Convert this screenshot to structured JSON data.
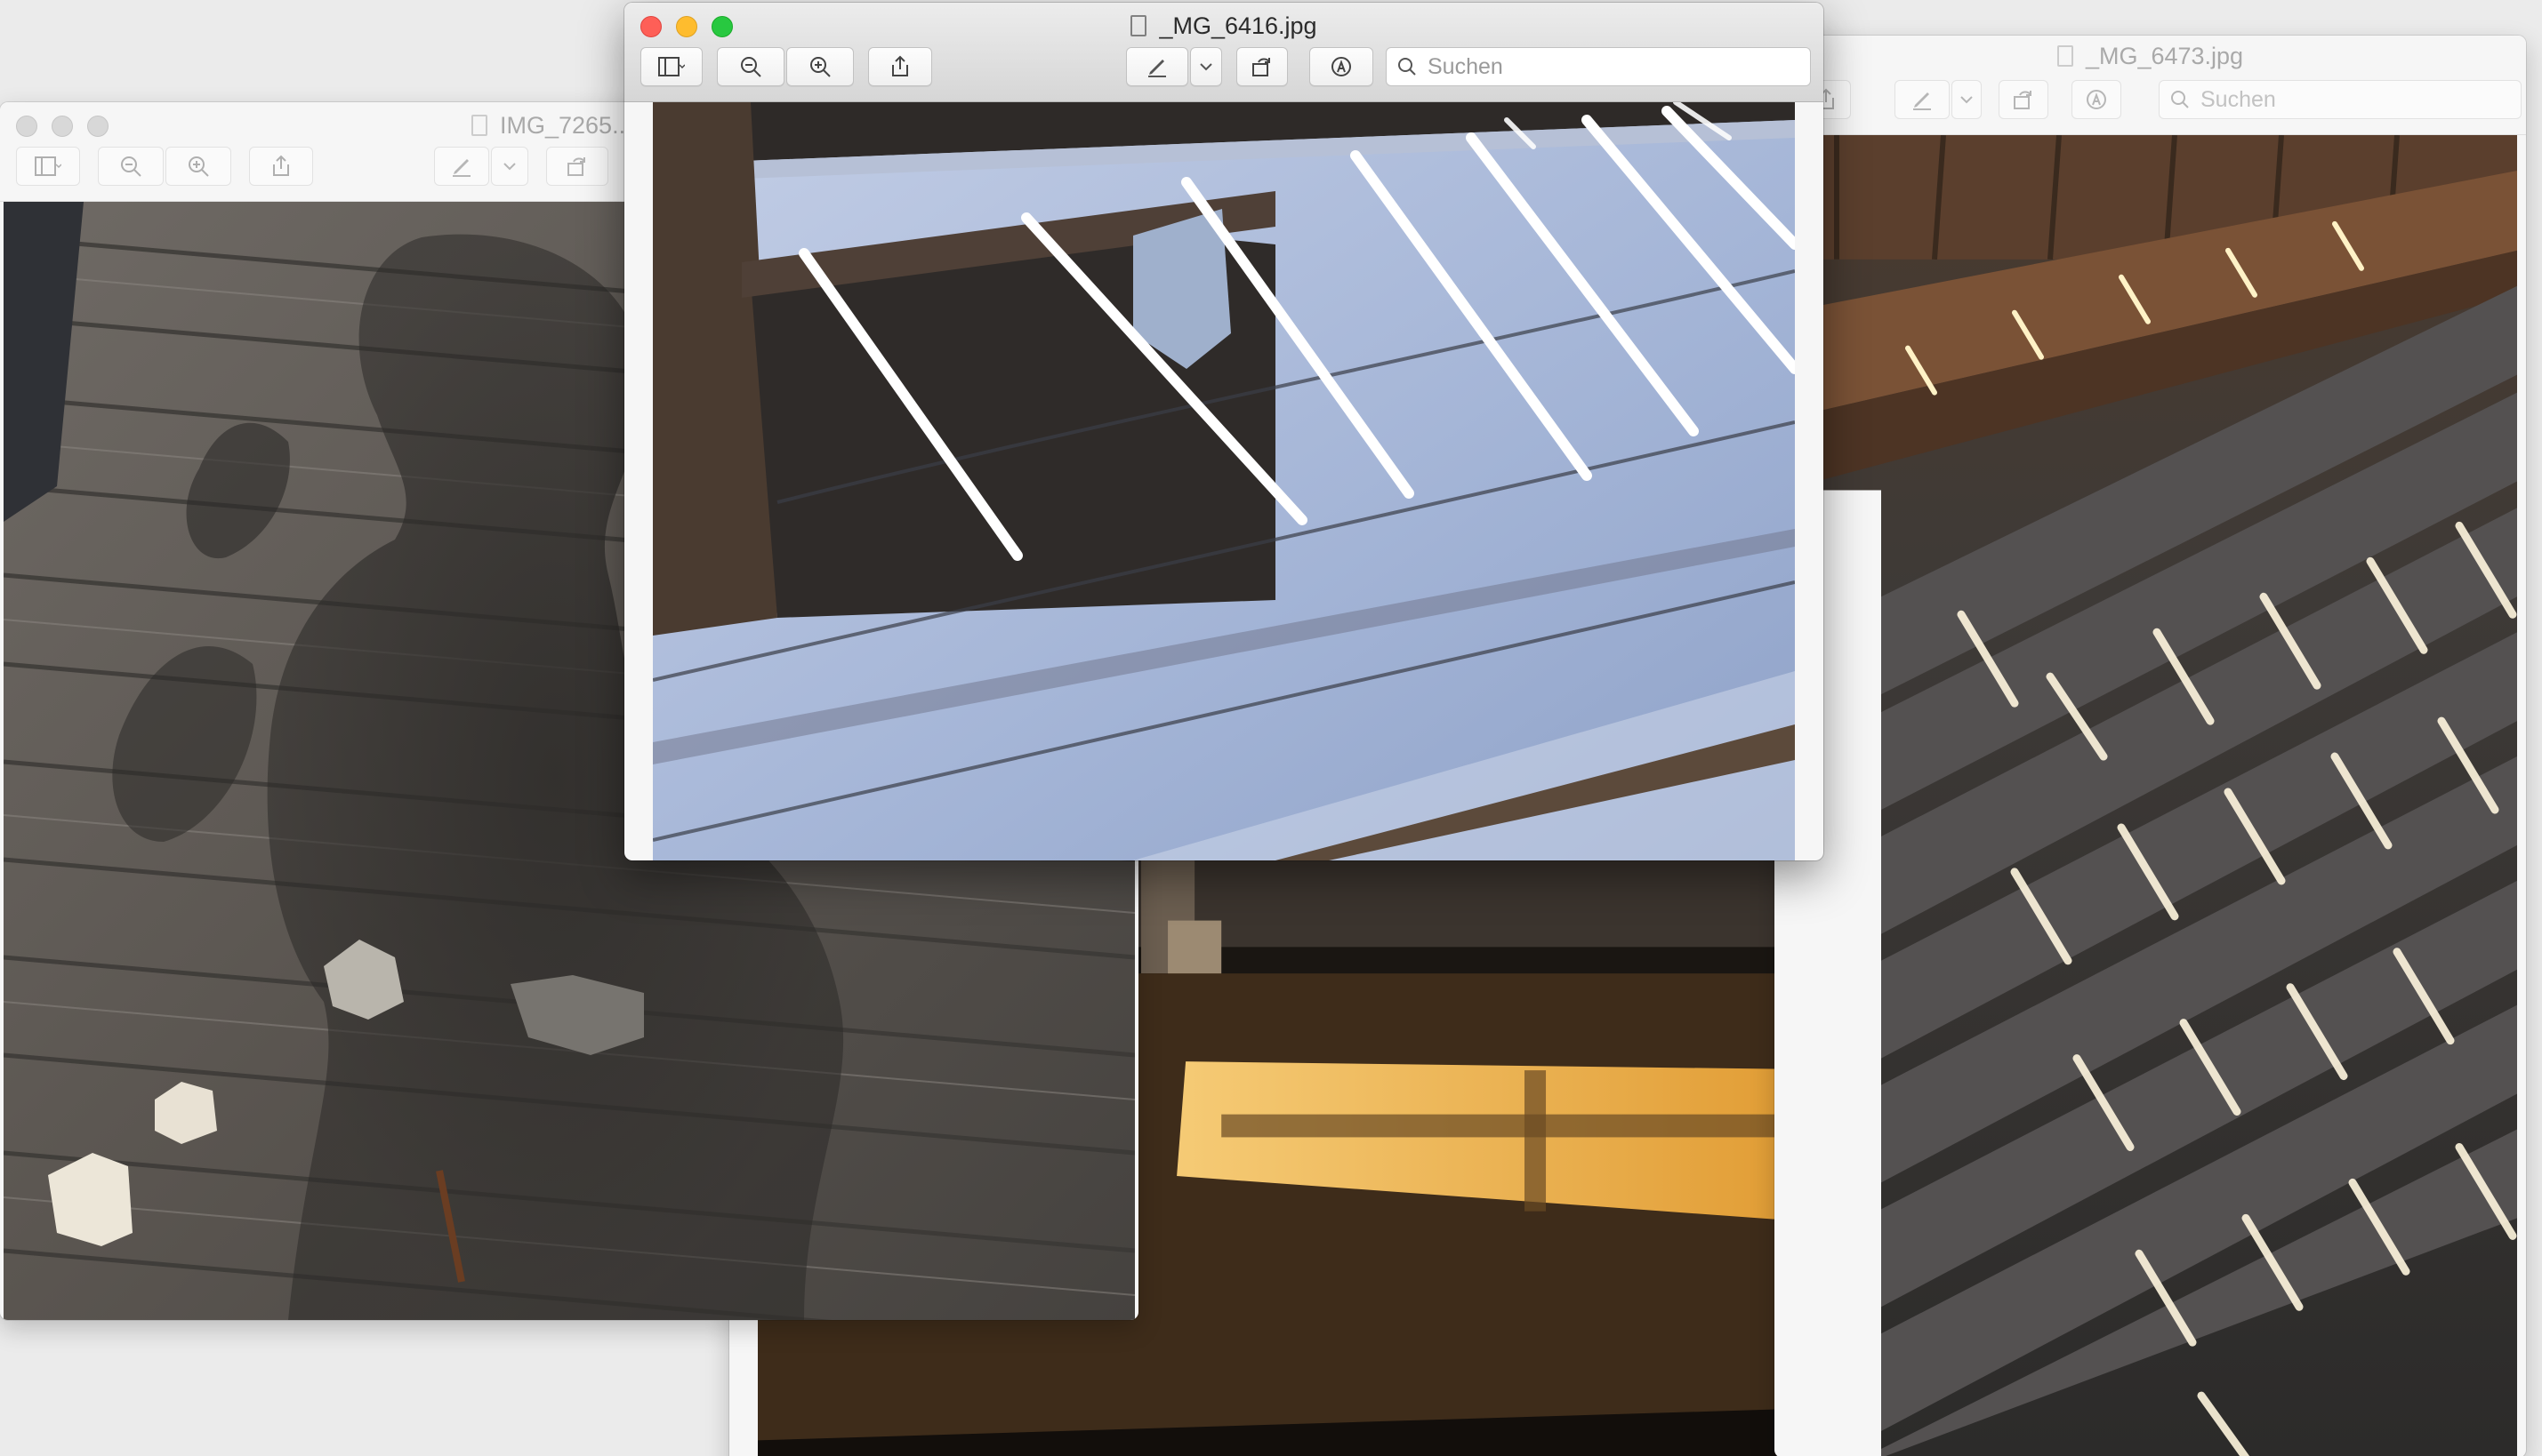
{
  "windows": {
    "left": {
      "title": "IMG_7265..."
    },
    "right": {
      "title": "_MG_6473.jpg",
      "search_placeholder": "Suchen"
    },
    "front": {
      "title": "_MG_6416.jpg",
      "search_placeholder": "Suchen"
    }
  },
  "photos": {
    "left": "wooden deck with a person's shadow and stones",
    "right": "wooden deck with stripes of sunlight",
    "middle": "room floor with window light patch",
    "front": "snow covered deck boards with light stripes"
  },
  "icons": [
    "sidebar-icon",
    "chevron-down-icon",
    "zoom-out-icon",
    "zoom-in-icon",
    "share-icon",
    "markup-pen-icon",
    "rotate-icon",
    "annotate-icon",
    "search-icon"
  ]
}
